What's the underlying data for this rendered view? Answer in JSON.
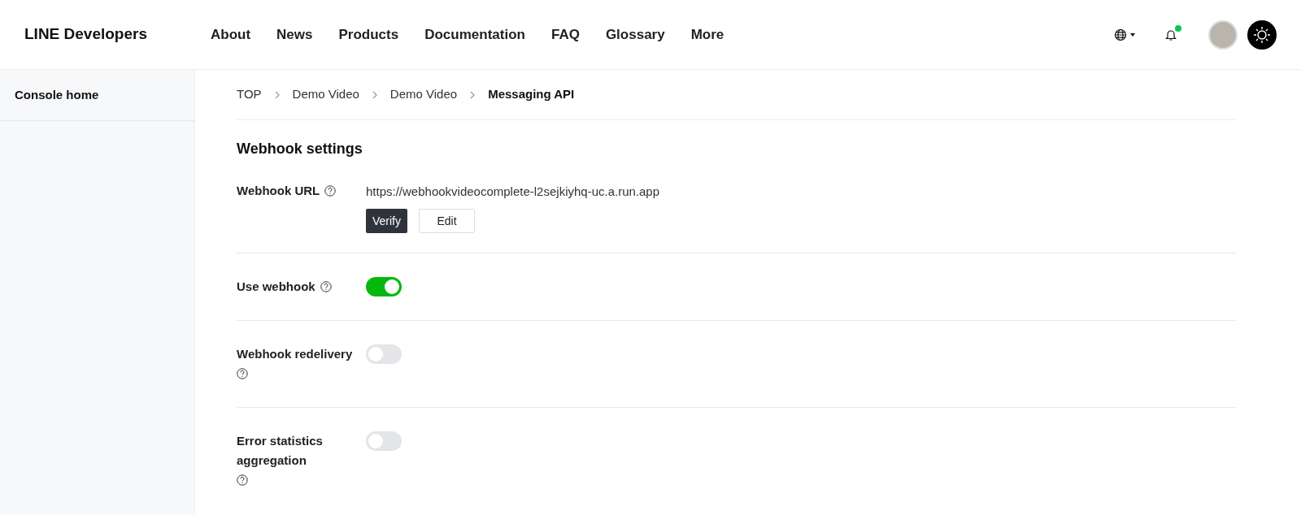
{
  "header": {
    "logo": "LINE Developers",
    "nav": [
      "About",
      "News",
      "Products",
      "Documentation",
      "FAQ",
      "Glossary",
      "More"
    ],
    "notification_unread": true
  },
  "sidebar": {
    "items": [
      "Console home"
    ]
  },
  "breadcrumb": [
    {
      "label": "TOP",
      "current": false
    },
    {
      "label": "Demo Video",
      "current": false
    },
    {
      "label": "Demo Video",
      "current": false
    },
    {
      "label": "Messaging API",
      "current": true
    }
  ],
  "section": {
    "title": "Webhook settings",
    "webhook_url": {
      "label": "Webhook URL",
      "value": "https://webhookvideocomplete-l2sejkiyhq-uc.a.run.app",
      "buttons": [
        {
          "label": "Verify",
          "kind": "primary"
        },
        {
          "label": "Edit",
          "kind": "secondary"
        }
      ]
    },
    "toggles": [
      {
        "label": "Use webhook",
        "on": true
      },
      {
        "label": "Webhook redelivery",
        "on": false
      },
      {
        "label": "Error statistics aggregation",
        "on": false
      }
    ]
  }
}
